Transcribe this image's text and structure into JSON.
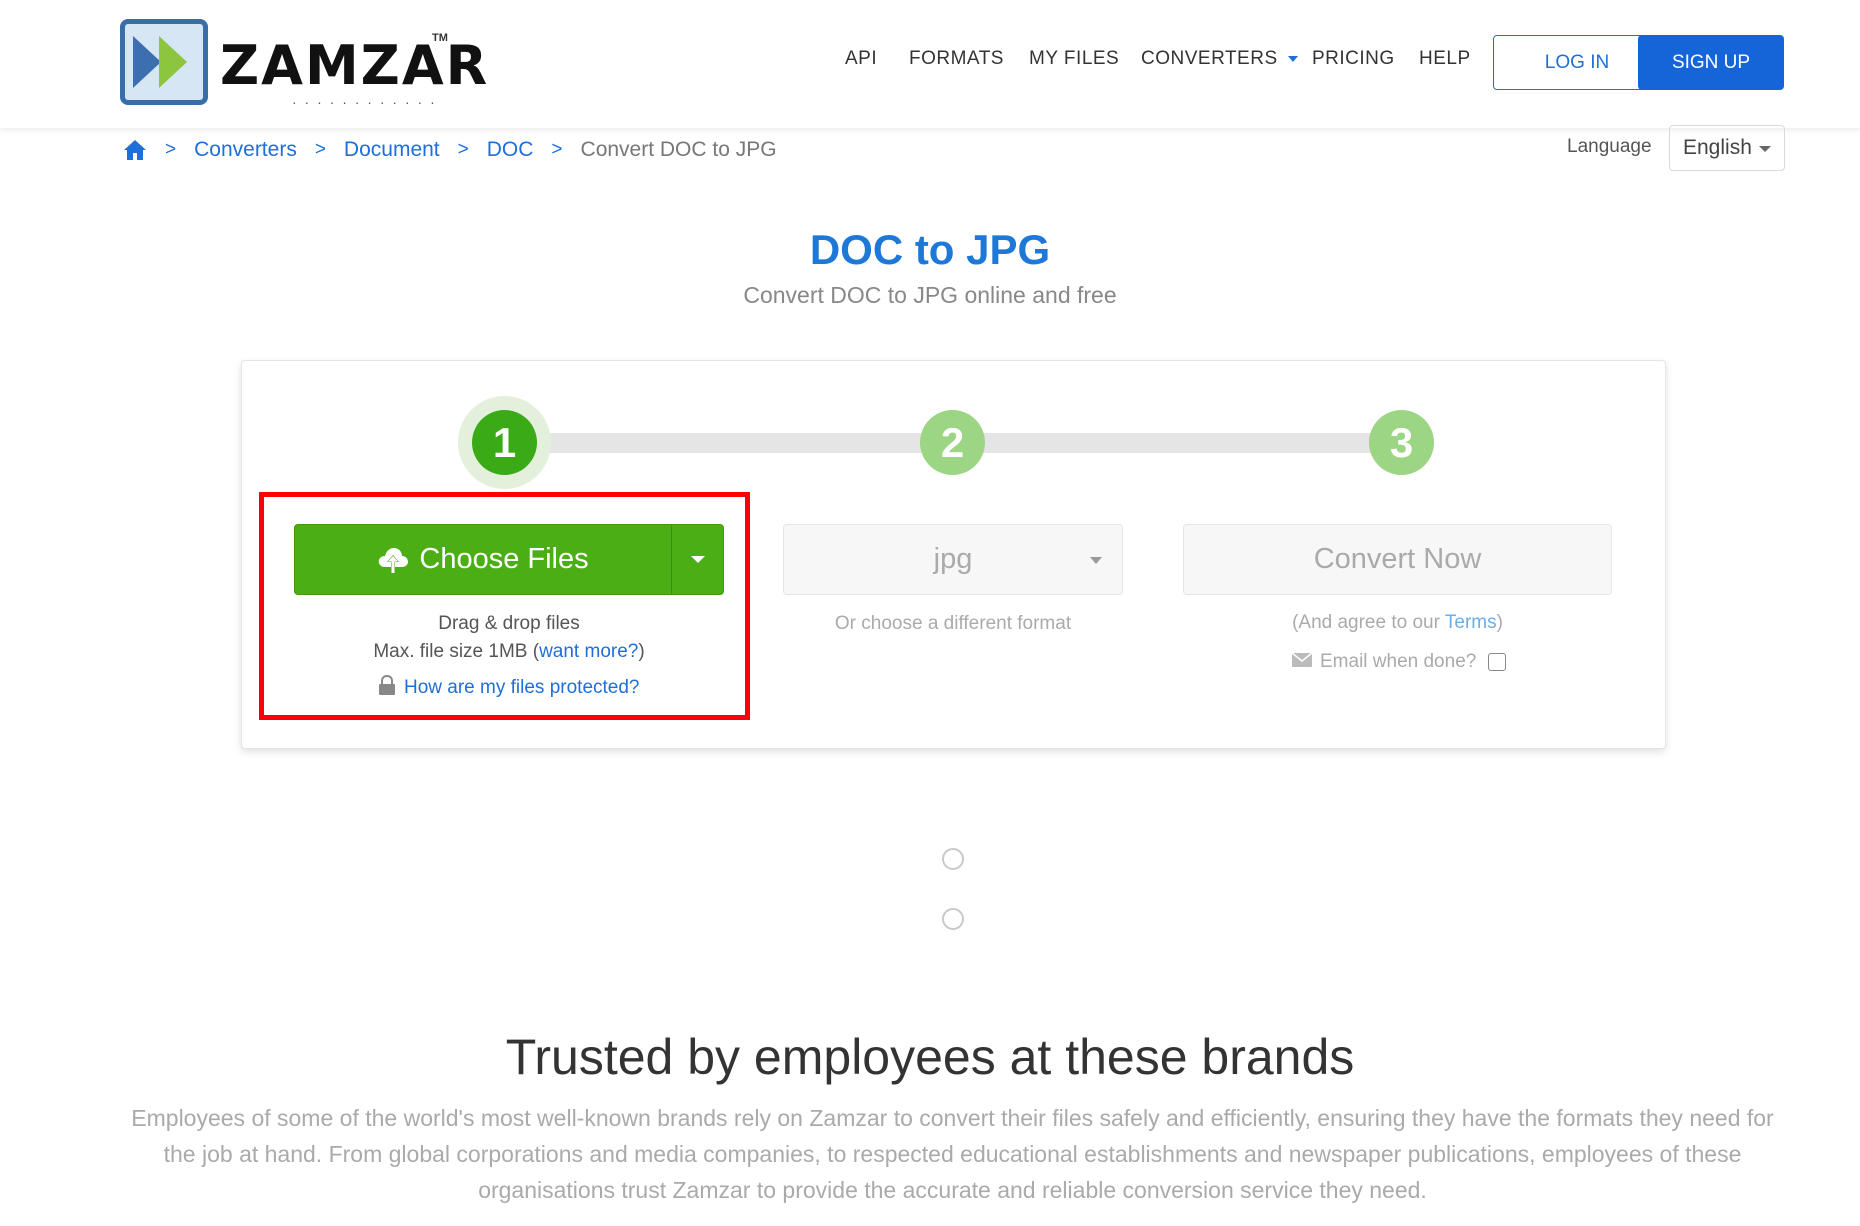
{
  "header": {
    "logo_text": "ZAMZAR",
    "logo_tm": "TM",
    "nav": [
      "API",
      "FORMATS",
      "MY FILES",
      "CONVERTERS",
      "PRICING",
      "HELP"
    ],
    "login_label": "LOG IN",
    "signup_label": "SIGN UP"
  },
  "breadcrumb": {
    "items": [
      "Converters",
      "Document",
      "DOC"
    ],
    "current": "Convert DOC to JPG",
    "separator": ">"
  },
  "language": {
    "label": "Language",
    "value": "English"
  },
  "hero": {
    "title": "DOC to JPG",
    "subtitle": "Convert DOC to JPG online and free"
  },
  "steps": [
    "1",
    "2",
    "3"
  ],
  "upload": {
    "button_label": "Choose Files",
    "drag_text": "Drag & drop files",
    "max_size_prefix": "Max. file size 1MB (",
    "want_more": "want more?",
    "max_size_suffix": ")",
    "protected_link": "How are my files protected?"
  },
  "format": {
    "selected": "jpg",
    "hint": "Or choose a different format"
  },
  "convert": {
    "button_label": "Convert Now",
    "agree_prefix": "(And agree to our ",
    "terms": "Terms",
    "agree_suffix": ")",
    "email_label": "Email when done?"
  },
  "trusted": {
    "heading": "Trusted by employees at these brands",
    "description": "Employees of some of the world's most well-known brands rely on Zamzar to convert their files safely and efficiently, ensuring they have the formats they need for the job at hand. From global corporations and media companies, to respected educational establishments and newspaper publications, employees of these organisations trust Zamzar to provide the accurate and reliable conversion service they need."
  },
  "colors": {
    "brand_blue": "#1e6fd9",
    "green": "#4cae15",
    "highlight": "#ff0000"
  }
}
